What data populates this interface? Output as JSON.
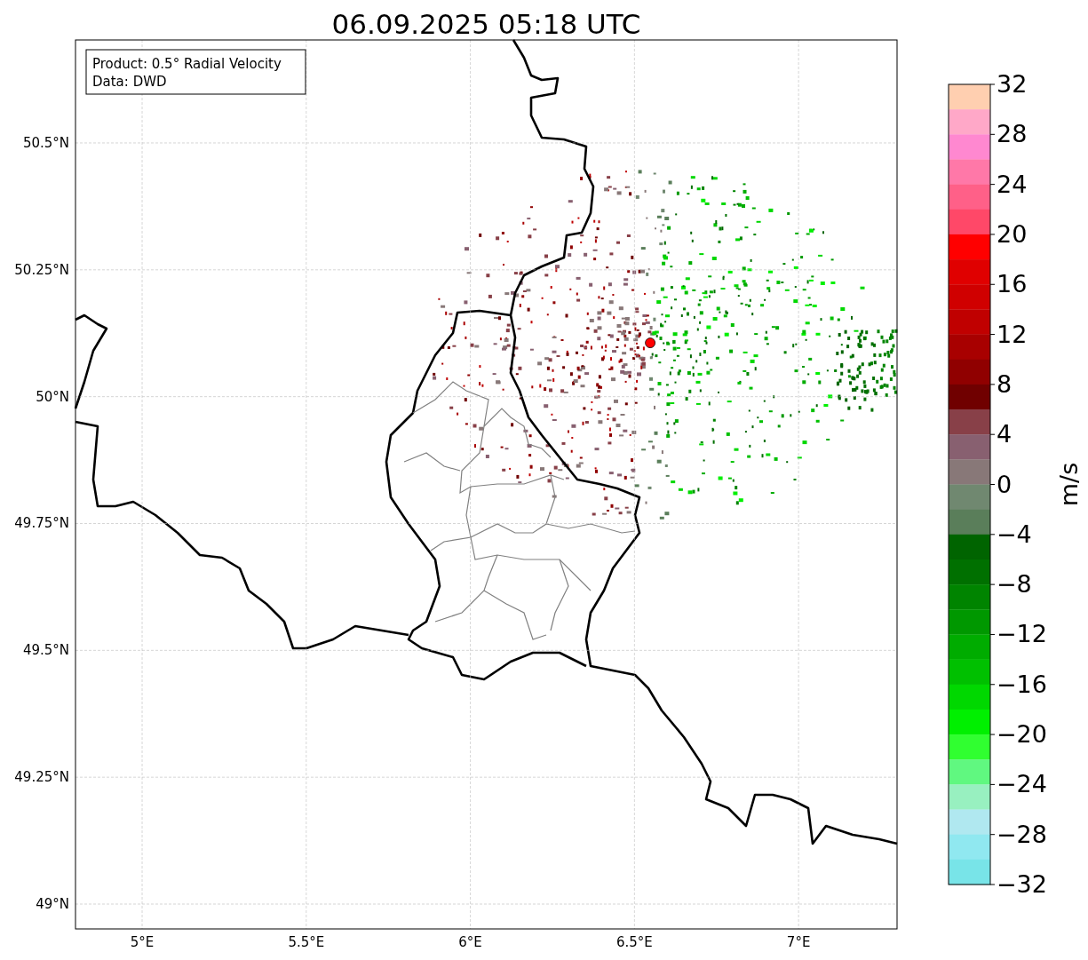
{
  "title": "06.09.2025 05:18 UTC",
  "info_box": {
    "lines": [
      "Product: 0.5° Radial Velocity",
      "Data: DWD"
    ]
  },
  "map": {
    "chart_data": {
      "type": "scatter",
      "grid": true,
      "xlim": [
        4.797,
        7.3
      ],
      "ylim": [
        48.951,
        50.703
      ],
      "xticks": [
        {
          "value": 5,
          "label": "5°E"
        },
        {
          "value": 5.5,
          "label": "5.5°E"
        },
        {
          "value": 6,
          "label": "6°E"
        },
        {
          "value": 6.5,
          "label": "6.5°E"
        },
        {
          "value": 7,
          "label": "7°E"
        }
      ],
      "yticks": [
        {
          "value": 50.5,
          "label": "50.5°N"
        },
        {
          "value": 50.25,
          "label": "50.25°N"
        },
        {
          "value": 50,
          "label": "50°N"
        },
        {
          "value": 49.75,
          "label": "49.75°N"
        },
        {
          "value": 49.5,
          "label": "49.5°N"
        },
        {
          "value": 49.25,
          "label": "49.25°N"
        },
        {
          "value": 49,
          "label": "49°N"
        }
      ],
      "series": [
        {
          "color": "#ff0000",
          "x": [
            6.548
          ],
          "values": [
            50.106
          ]
        }
      ]
    }
  },
  "colorbar": {
    "label": "m/s",
    "ticks": [
      "32",
      "28",
      "24",
      "20",
      "16",
      "12",
      "8",
      "4",
      "0",
      "−4",
      "−8",
      "−12",
      "−16",
      "−20",
      "−24",
      "−28",
      "−32"
    ],
    "bands": [
      {
        "color": "#ffcfb0"
      },
      {
        "color": "#ffa8c8"
      },
      {
        "color": "#ff88d0"
      },
      {
        "color": "#ff78a8"
      },
      {
        "color": "#ff6088"
      },
      {
        "color": "#ff4868"
      },
      {
        "color": "#ff0000"
      },
      {
        "color": "#e00000"
      },
      {
        "color": "#d00000"
      },
      {
        "color": "#c00000"
      },
      {
        "color": "#a80000"
      },
      {
        "color": "#900000"
      },
      {
        "color": "#700000"
      },
      {
        "color": "#884048"
      },
      {
        "color": "#886070"
      },
      {
        "color": "#887878"
      },
      {
        "color": "#708870"
      },
      {
        "color": "#5a7e5a"
      },
      {
        "color": "#006400"
      },
      {
        "color": "#007000"
      },
      {
        "color": "#008400"
      },
      {
        "color": "#009800"
      },
      {
        "color": "#00ac00"
      },
      {
        "color": "#00c000"
      },
      {
        "color": "#00d800"
      },
      {
        "color": "#00f000"
      },
      {
        "color": "#30ff30"
      },
      {
        "color": "#60f880"
      },
      {
        "color": "#98f0c0"
      },
      {
        "color": "#b0e8f0"
      },
      {
        "color": "#90e8f0"
      },
      {
        "color": "#78e4e8"
      }
    ]
  }
}
